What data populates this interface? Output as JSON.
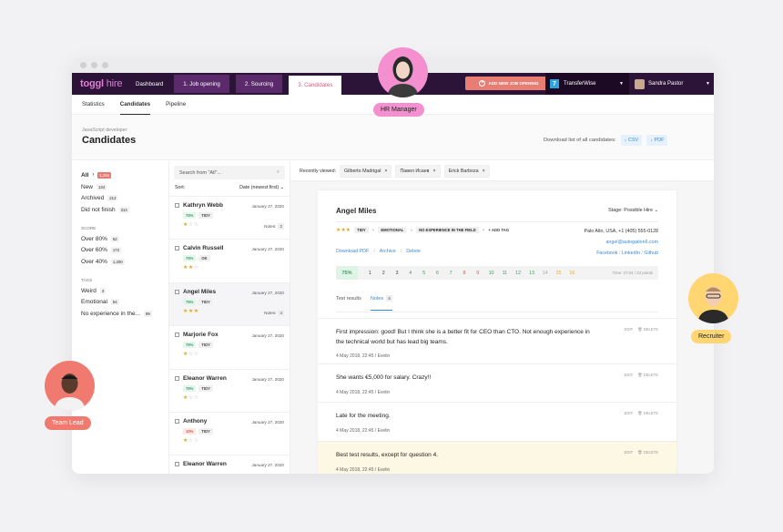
{
  "nav": {
    "logo": "toggl",
    "logo_sub": "hire",
    "dashboard": "Dashboard",
    "job_opening": "1. Job opening",
    "sourcing": "2. Sourcing",
    "candidates": "3. Candidates",
    "add_job": "ADD NEW JOB OPENING",
    "org": "TransferWise",
    "user": "Sandra Pastor"
  },
  "subnav": {
    "statistics": "Statistics",
    "candidates": "Candidates",
    "pipeline": "Pipeline"
  },
  "header": {
    "crumb": "JavaScript developer",
    "title": "Candidates",
    "download_label": "Download list of all candidates:",
    "csv": "↓ CSV",
    "pdf": "↓ PDF"
  },
  "filters": {
    "all": "All",
    "all_count": "1,294",
    "new": "New",
    "new_count": "134",
    "archived": "Archived",
    "archived_count": "212",
    "dnf": "Did not finish",
    "dnf_count": "314",
    "score_label": "SCORE",
    "s80": "Over 80%",
    "s80_count": "62",
    "s60": "Over 60%",
    "s60_count": "172",
    "s40": "Over 40%",
    "s40_count": "1,200",
    "tags_label": "TAGS",
    "weird": "Weird",
    "weird_count": "3",
    "emotional": "Emotional",
    "emotional_count": "54",
    "noexp": "No experience in the...",
    "noexp_count": "89"
  },
  "list": {
    "search_placeholder": "Search from \"All\"...",
    "sort_label": "Sort:",
    "sort_value": "Date (newest first) ⌄",
    "items": [
      {
        "name": "Kathryn Webb",
        "date": "January 27, 2020",
        "pct": "75%",
        "tag": "TIDY",
        "stars": 1,
        "notes": "2"
      },
      {
        "name": "Calvin Russell",
        "date": "January 27, 2020",
        "pct": "75%",
        "tag": "OK",
        "stars": 2,
        "notes": ""
      },
      {
        "name": "Angel Miles",
        "date": "January 27, 2020",
        "pct": "75%",
        "tag": "TIDY",
        "stars": 3,
        "notes": "4"
      },
      {
        "name": "Marjorie Fox",
        "date": "January 27, 2020",
        "pct": "75%",
        "tag": "TIDY",
        "stars": 1,
        "notes": ""
      },
      {
        "name": "Eleanor Warren",
        "date": "January 27, 2020",
        "pct": "75%",
        "tag": "TIDY",
        "stars": 1,
        "notes": ""
      },
      {
        "name": "Anthony",
        "date": "January 27, 2020",
        "pct": "10%",
        "tag": "TIDY",
        "stars": 1,
        "notes": ""
      },
      {
        "name": "Eleanor Warren",
        "date": "January 27, 2020",
        "pct": "",
        "tag": "",
        "stars": 0,
        "notes": ""
      }
    ],
    "notes_label": "Notes:"
  },
  "recent": {
    "label": "Recently viewed:",
    "chips": [
      "Gilberto Madrigal",
      "Павел Исаев",
      "Erick Barboza"
    ]
  },
  "profile": {
    "name": "Angel Miles",
    "stage": "Stage: Possible Hire ⌄",
    "tags": [
      "TIDY",
      "EMOTIONAL",
      "NO EXPERIENCE IN THE FIELD"
    ],
    "add_tag": "+ ADD TAG",
    "location": "Palo Alto, USA, +1 (405) 555-0128",
    "email": "angel@autogation6.com",
    "social_fb": "Facebook",
    "social_li": "LinkedIn",
    "social_gh": "Github",
    "download_pdf": "Download PDF",
    "archive": "Archive",
    "delete": "Delete",
    "score": "75%",
    "questions": [
      "1",
      "2",
      "3",
      "4",
      "5",
      "6",
      "7",
      "8",
      "9",
      "10",
      "11",
      "12",
      "13",
      "14",
      "15",
      "16"
    ],
    "time": "Time: 27:04 / 23 points",
    "tab_tests": "Test results",
    "tab_notes": "Notes",
    "tab_notes_count": "4"
  },
  "notes": [
    {
      "text": "First impression: good! But I think she is a better fit for CEO than CTO. Not enough experience in the technical world but has lead big teams.",
      "meta": "4 May 2018, 22:45  /  Evelin"
    },
    {
      "text": "She wants €5,000 for salary. Crazy!!",
      "meta": "4 May 2018, 22:45  /  Evelin"
    },
    {
      "text": "Late for the meeting.",
      "meta": "4 May 2018, 22:45  /  Evelin"
    },
    {
      "text": "Best test results, except for question 4.",
      "meta": "4 May 2018, 22:45  /  Evelin"
    }
  ],
  "note_edit": "EDIT",
  "note_delete": "DELETE",
  "personas": {
    "hr": "HR Manager",
    "recruiter": "Recruiter",
    "lead": "Team Lead"
  },
  "colors": {
    "topbar": "#2c1338",
    "accent": "#e0577a",
    "link": "#3d8ad9",
    "hr": "#f490d0",
    "recruiter": "#ffd672",
    "lead": "#f07a6f"
  }
}
